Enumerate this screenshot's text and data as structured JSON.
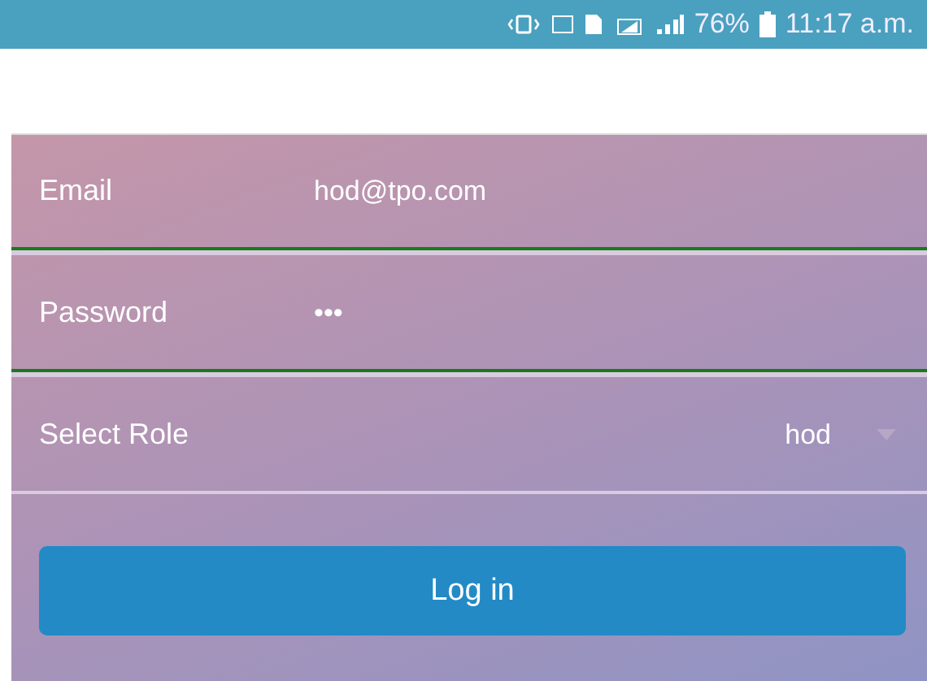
{
  "status_bar": {
    "battery": "76%",
    "time": "11:17 a.m."
  },
  "fields": [
    {
      "kind": "text",
      "label": "Email",
      "value": "hod@tpo.com",
      "valid": true
    },
    {
      "kind": "text",
      "label": "Password",
      "value": "•••",
      "valid": true
    },
    {
      "kind": "select",
      "label": "Select Role",
      "value": "hod",
      "valid": false
    }
  ],
  "login_button": "Log in"
}
